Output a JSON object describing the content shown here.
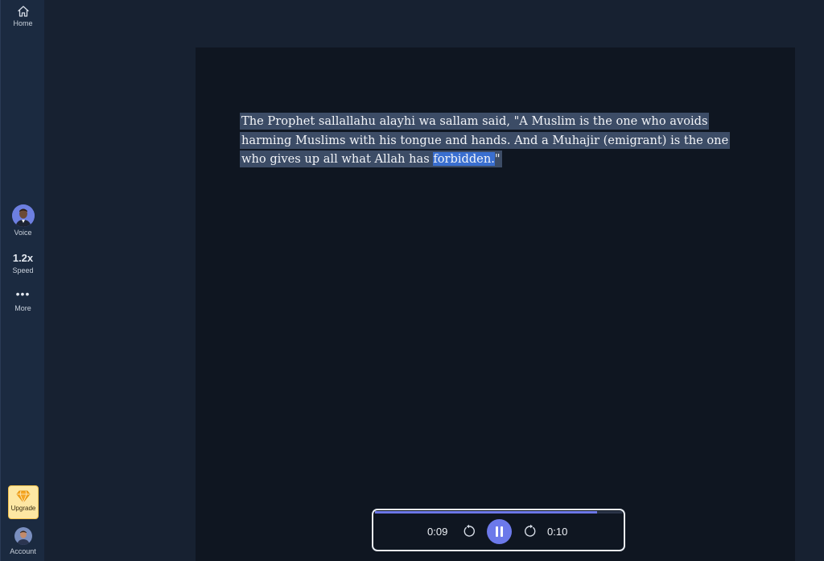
{
  "sidebar": {
    "home_label": "Home",
    "voice_label": "Voice",
    "speed_value": "1.2x",
    "speed_label": "Speed",
    "more_label": "More",
    "upgrade_label": "Upgrade",
    "account_label": "Account"
  },
  "reader": {
    "text_before": "The Prophet sallallahu alayhi wa sallam said, \"A Muslim is the one who avoids harming Muslims with his tongue and hands. And a Muhajir (emigrant) is the one who gives up all what Allah has ",
    "current_word": "forbidden.",
    "text_after": "\""
  },
  "player": {
    "current_time": "0:09",
    "total_time": "0:10",
    "progress": 0.9
  },
  "colors": {
    "accent": "#6c79ea",
    "highlight": "#3c4c66",
    "current_word": "#3a6fd0",
    "upgrade": "#fde7a3"
  },
  "icons": [
    "home-icon",
    "voice-avatar-icon",
    "more-icon",
    "diamond-icon",
    "account-avatar-icon",
    "skip-back-icon",
    "pause-icon",
    "skip-forward-icon"
  ]
}
